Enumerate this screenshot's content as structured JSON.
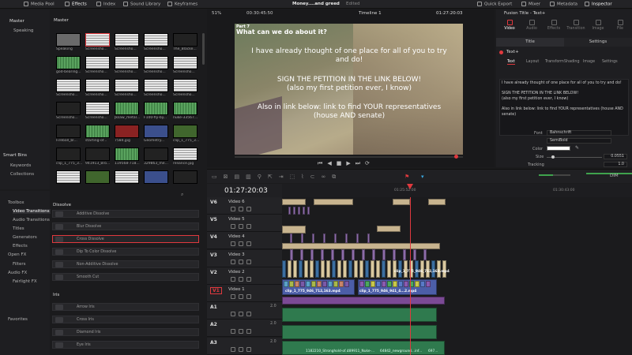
{
  "topbar": {
    "media_pool": "Media Pool",
    "effects": "Effects",
    "index": "Index",
    "sound_library": "Sound Library",
    "keyframes": "Keyframes",
    "project_title": "Money....and greed",
    "edited": "Edited",
    "quick_export": "Quick Export",
    "mixer": "Mixer",
    "metadata": "Metadata",
    "inspector": "Inspector"
  },
  "viewer_bar": {
    "zoom": "51%",
    "duration": "00:30:45:50",
    "timeline_name": "Timeline 1",
    "timecode": "01:27:20:03"
  },
  "media_pool": {
    "master_label": "Master",
    "bins": [
      "Master",
      "Speaking"
    ],
    "clips": [
      {
        "label": "Speaking",
        "kind": "folder"
      },
      {
        "label": "Screensho...",
        "kind": "doc"
      },
      {
        "label": "Screensho...",
        "kind": "doc"
      },
      {
        "label": "Screensho...",
        "kind": "doc"
      },
      {
        "label": "The_Blacke...",
        "kind": "dark"
      },
      {
        "label": "god-bearing...",
        "kind": "audio"
      },
      {
        "label": "Screensho...",
        "kind": "doc"
      },
      {
        "label": "Screensho...",
        "kind": "doc"
      },
      {
        "label": "Screensho...",
        "kind": "doc"
      },
      {
        "label": "Screensho...",
        "kind": "doc"
      },
      {
        "label": "Screensho...",
        "kind": "doc"
      },
      {
        "label": "Screensho...",
        "kind": "doc"
      },
      {
        "label": "Screensho...",
        "kind": "doc"
      },
      {
        "label": "Screensho...",
        "kind": "doc"
      },
      {
        "label": "Screensho...",
        "kind": "doc"
      },
      {
        "label": "Screensho...",
        "kind": "dark"
      },
      {
        "label": "Screensho...",
        "kind": "doc"
      },
      {
        "label": "Jksaw_metal...",
        "kind": "audio"
      },
      {
        "label": "F100-fly-by...",
        "kind": "audio"
      },
      {
        "label": "nuke-33567...",
        "kind": "audio"
      },
      {
        "label": "Fireball_bl...",
        "kind": "dark"
      },
      {
        "label": "starting-of...",
        "kind": "audio"
      },
      {
        "label": "7584.jpg",
        "kind": "red"
      },
      {
        "label": "Geometry...",
        "kind": "blue"
      },
      {
        "label": "clip_1_775_3...",
        "kind": "green"
      },
      {
        "label": "clip_1_775_3...",
        "kind": "dark"
      },
      {
        "label": "941913_Bro...",
        "kind": "dark"
      },
      {
        "label": "119568-718...",
        "kind": "audio"
      },
      {
        "label": "329863_me...",
        "kind": "dark"
      },
      {
        "label": "reliance.jpg",
        "kind": "doc"
      },
      {
        "label": "",
        "kind": "doc"
      },
      {
        "label": "",
        "kind": "green"
      },
      {
        "label": "",
        "kind": "doc"
      },
      {
        "label": "",
        "kind": "blue"
      },
      {
        "label": "",
        "kind": "dark"
      }
    ]
  },
  "smart_bins": {
    "title": "Smart Bins",
    "items": [
      "Keywords",
      "Collections"
    ]
  },
  "toolbox": {
    "items": [
      "Toolbox",
      "Video Transitions",
      "Audio Transitions",
      "Titles",
      "Generators",
      "Effects",
      "Open FX",
      "Filters",
      "Audio FX",
      "Fairlight FX",
      "Favorites"
    ]
  },
  "effects_list": {
    "dissolve_header": "Dissolve",
    "dissolve": [
      "Additive Dissolve",
      "Blur Dissolve",
      "Cross Dissolve",
      "Dip To Color Dissolve",
      "Non-Additive Dissolve",
      "Smooth Cut"
    ],
    "iris_header": "Iris",
    "iris": [
      "Arrow Iris",
      "Cross Iris",
      "Diamond Iris",
      "Eye Iris"
    ]
  },
  "viewer": {
    "part": "Part 7",
    "line1": "What can we do about it?",
    "para1": "I have already thought of one place for all of you to try and do!",
    "para2a": "SIGN THE PETITION IN THE LINK BELOW!",
    "para2b": "(also my first petition ever, I know)",
    "para3": "Also in link below: link to find YOUR representatives (house AND senate)"
  },
  "timeline": {
    "timecode": "01:27:20:03",
    "ruler_marks": [
      "01:25:52:00",
      "01:30:43:00"
    ],
    "tracks": [
      {
        "id": "V6",
        "name": "Video 6",
        "type": "video"
      },
      {
        "id": "V5",
        "name": "Video 5",
        "type": "video"
      },
      {
        "id": "V4",
        "name": "Video 4",
        "type": "video"
      },
      {
        "id": "V3",
        "name": "Video 3",
        "type": "video"
      },
      {
        "id": "V2",
        "name": "Video 2",
        "type": "video"
      },
      {
        "id": "V1",
        "name": "Video 1",
        "type": "video"
      },
      {
        "id": "A1",
        "name": "",
        "type": "audio",
        "level": "2.0"
      },
      {
        "id": "A2",
        "name": "",
        "type": "audio",
        "level": "2.0"
      },
      {
        "id": "A3",
        "name": "",
        "type": "audio",
        "level": "2.0"
      }
    ],
    "clip_labels": [
      "clip_1_775_946_712,163.mp4",
      "clip_1_775_946_941_4...2.mp4",
      "1182210_Stronghold-of...",
      "489911_Nuke-...",
      "64842_newground...inf...",
      "697..."
    ]
  },
  "inspector": {
    "title": "Fusion Title - Text+",
    "tabs": [
      "Video",
      "Audio",
      "Effects",
      "Transition",
      "Image",
      "File"
    ],
    "subtabs": [
      "Title",
      "Settings"
    ],
    "node_name": "Text+",
    "tool_tabs": [
      "Text",
      "Layout",
      "Transform",
      "Shading",
      "Image",
      "Settings"
    ],
    "text_content": "I have already thought of one place for all of you to try and do!\n\nSIGN THE PETITION IN THE LINK BELOW!\n(also my first petition ever, I know)\n\nAlso in link below: link to find YOUR representatives (house AND senate)",
    "font_label": "Font",
    "font_value": "Bahnschrift",
    "style_value": "SemiBold",
    "color_label": "Color",
    "size_label": "Size",
    "size_value": "0.0551",
    "tracking_label": "Tracking",
    "tracking_value": "1.0"
  },
  "mix": {
    "dim": "DIM"
  }
}
